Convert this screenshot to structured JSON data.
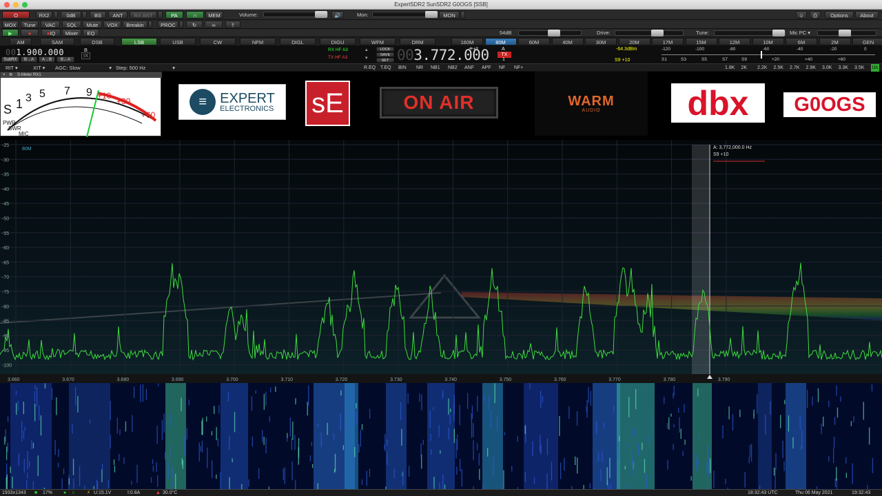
{
  "window": {
    "title": "ExpertSDR2 SunSDR2  G0OGS  [SSB]"
  },
  "toolbar1": {
    "rx2": "RX2",
    "odb": "0dB",
    "bs": "BS",
    "ant": "ANT",
    "rxant": "RX ANT",
    "pa": "PA",
    "mem": "MEM",
    "volume_label": "Volume:",
    "mon_label": "Mon:",
    "mon_value": "MON",
    "options": "Options",
    "about": "About"
  },
  "toolbar2": {
    "mox": "MOX",
    "tune": "Tune",
    "vac": "VAC",
    "sql": "SQL",
    "mute": "Mute",
    "vox": "VOX",
    "breakin": "Breakin",
    "proc": "PROC"
  },
  "toolbar3": {
    "iq": "IQ",
    "mixer": "Mixer",
    "eq": "EQ",
    "attn": "54dB",
    "drive_label": "Drive:",
    "tune_label": "Tune:",
    "micpc": "Mic PC"
  },
  "modes": [
    "AM",
    "SAM",
    "DSB",
    "LSB",
    "USB",
    "CW",
    "NFM",
    "DIGL",
    "DIGU",
    "WFM",
    "DRM"
  ],
  "selected_mode": "LSB",
  "bands": [
    "160M",
    "80M",
    "60M",
    "40M",
    "30M",
    "20M",
    "17M",
    "15M",
    "12M",
    "10M",
    "6M",
    "2M",
    "GEN"
  ],
  "selected_band": "80M",
  "vfo": {
    "sub_freq": "1.900.000",
    "sub_label": "B",
    "sub_badge": "IX",
    "subrx": "SubRX",
    "btn_ba": "B→A",
    "btn_ab": "A→B",
    "btn_bab": "B↔A",
    "rxhf": "RX HF",
    "rxhf_a": "A3",
    "txhf": "TX HF",
    "txhf_a": "A3",
    "lock": "LOCK",
    "save": "SAVE",
    "set": "SET",
    "main_prefix": "00",
    "main_freq": "3.772.000",
    "vfo_a": "A",
    "vfo_tx": "TX",
    "vfo_1": "1"
  },
  "meter": {
    "dbm": "-64.3dBm",
    "s_reading": "S9 +10",
    "scale_top": [
      "-120",
      "-100",
      "-80",
      "-60",
      "-40",
      "-20",
      "0"
    ],
    "scale_bottom": [
      "S1",
      "S3",
      "S5",
      "S7",
      "S9",
      "+20",
      "+40",
      "+60"
    ]
  },
  "row4": {
    "rit": "RIT",
    "xit": "XIT",
    "agc": "AGC: Slow",
    "step": "Step: 500 Hz",
    "buttons": [
      "R.EQ",
      "T.EQ",
      "BIN",
      "NR",
      "NB1",
      "NB2",
      "ANF",
      "APF",
      "NF",
      "NF+"
    ],
    "filters": [
      "1.8K",
      "2K",
      "2.2K",
      "2.5K",
      "2.7K",
      "2.9K",
      "3.0K",
      "3.3K",
      "3.5K",
      "Us"
    ]
  },
  "smeter_panel": {
    "title": "S-Meter RX1",
    "arc_nums": [
      "1",
      "3",
      "5",
      "7",
      "9",
      "+10",
      "+30",
      "+60"
    ],
    "pwr": "PWR",
    "swr": "SWR",
    "mic": "MIC"
  },
  "logos": {
    "expert_top": "EXPERT",
    "expert_bottom": "ELECTRONICS",
    "se": "sE",
    "onair": "ON AIR",
    "warm": "WARM",
    "warm_sub": "AUDIO",
    "dbx": "dbx",
    "googs": "G0OGS"
  },
  "spectrum": {
    "band_label": "80M",
    "cursor_freq": "A: 3,772,000.0 Hz",
    "cursor_s": "S9 +10",
    "y_ticks": [
      "-25",
      "-30",
      "-35",
      "-40",
      "-45",
      "-50",
      "-55",
      "-60",
      "-65",
      "-70",
      "-75",
      "-80",
      "-85",
      "-90",
      "-95",
      "-100"
    ],
    "x_ticks": [
      "3.660",
      "3.670",
      "3.680",
      "3.690",
      "3.700",
      "3.710",
      "3.720",
      "3.730",
      "3.740",
      "3.750",
      "3.760",
      "3.770",
      "3.780",
      "3.790"
    ]
  },
  "status": {
    "res": "1933x1343",
    "cpu": "17%",
    "volt": "U:15.1V",
    "amp": "I:0.8A",
    "temp": "30.0°C",
    "utc": "18:32:43 UTC",
    "date": "Thu 06 May 2021",
    "local": "19:32:43"
  },
  "colors": {
    "accent": "#3a7bb8",
    "onair": "#e0302a",
    "spectrum": "#3fdc3f",
    "dbx": "#d8132a"
  }
}
